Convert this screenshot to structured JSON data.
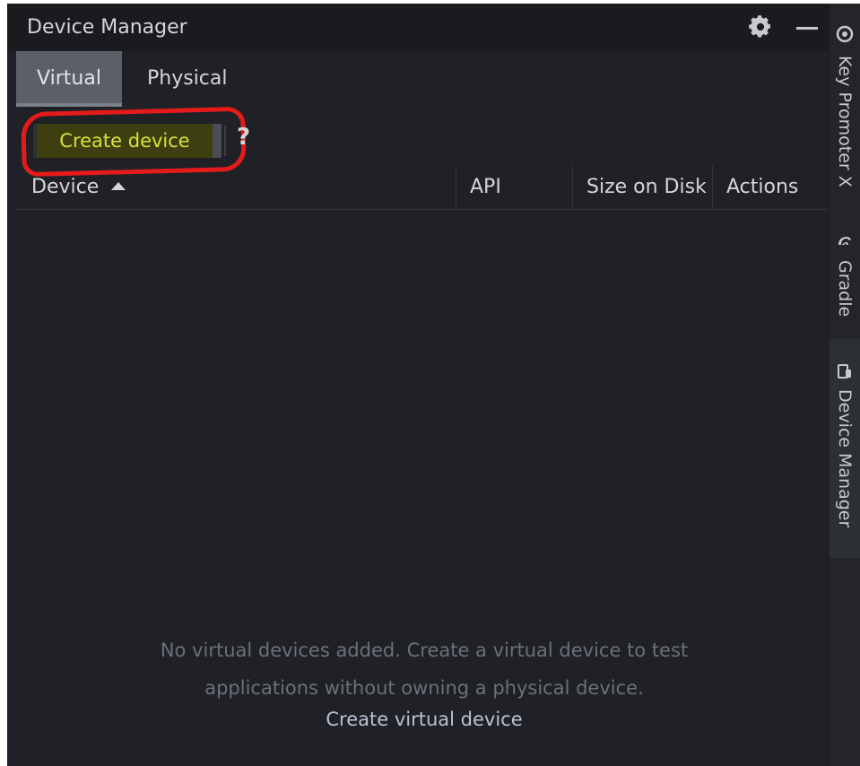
{
  "window": {
    "title": "Device Manager"
  },
  "tabs": [
    {
      "label": "Virtual",
      "active": true
    },
    {
      "label": "Physical",
      "active": false
    }
  ],
  "toolbar": {
    "create_label": "Create device",
    "help_label": "?"
  },
  "table": {
    "columns": [
      "Device",
      "API",
      "Size on Disk",
      "Actions"
    ],
    "sort_column": "Device",
    "sort_direction": "ascending"
  },
  "empty_state": {
    "line1": "No virtual devices added. Create a virtual device to test",
    "line2": "applications without owning a physical device.",
    "link": "Create virtual device"
  },
  "side_stripe": [
    {
      "label": "Key Promoter X",
      "icon": "key-promoter-icon",
      "active": false
    },
    {
      "label": "Gradle",
      "icon": "gradle-elephant-icon",
      "active": false
    },
    {
      "label": "Device Manager",
      "icon": "device-manager-icon",
      "active": true
    }
  ],
  "colors": {
    "background": "#1f2126",
    "accent_text": "#d8e03a",
    "highlight_ring": "#e31b1b",
    "link": "#b7c3d3"
  }
}
